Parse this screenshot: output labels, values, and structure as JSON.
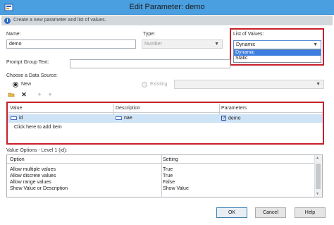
{
  "window": {
    "title": "Edit Parameter: demo"
  },
  "info": {
    "text": "Create a new parameter and list of values."
  },
  "name": {
    "label": "Name:",
    "value": "demo"
  },
  "type": {
    "label": "Type:",
    "value": "Number"
  },
  "list_of_values": {
    "label": "List of Values:",
    "selected": "Dynamic",
    "options": [
      "Dynamic",
      "Static"
    ],
    "highlight_color": "#c8202a"
  },
  "prompt_group": {
    "label": "Prompt Group Text:",
    "value": ""
  },
  "data_source": {
    "label": "Choose a Data Source:",
    "new_label": "New",
    "existing_label": "Existing",
    "selected": "New"
  },
  "grid": {
    "columns": [
      "Value",
      "Description",
      "Parameters"
    ],
    "rows": [
      {
        "value": "id",
        "description": "nae",
        "parameters": "demo"
      }
    ],
    "add_item_text": "Click here to add item"
  },
  "value_options": {
    "label": "Value Options - Level 1 (id):",
    "columns": [
      "Option",
      "Setting"
    ],
    "rows": [
      {
        "option": "Allow multiple values",
        "setting": "True"
      },
      {
        "option": "Allow discrete values",
        "setting": "True"
      },
      {
        "option": "Allow range values",
        "setting": "False"
      },
      {
        "option": "Show Value or Description",
        "setting": "Show Value"
      }
    ]
  },
  "buttons": {
    "ok": "OK",
    "cancel": "Cancel",
    "help": "Help"
  },
  "colors": {
    "titlebar": "#4a9fe0",
    "selection": "#3d7ee0",
    "row_highlight": "#cfe3f6"
  }
}
